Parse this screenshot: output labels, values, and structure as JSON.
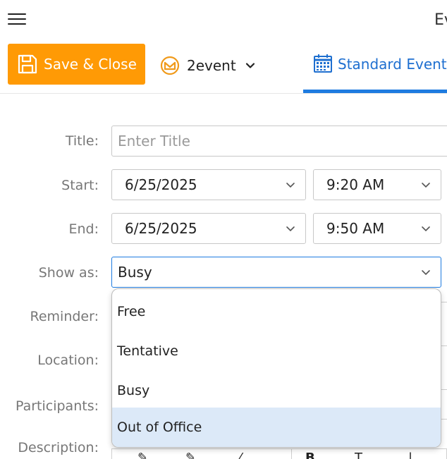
{
  "window": {
    "title": "Ev"
  },
  "toolbar": {
    "save_label": "Save & Close",
    "account_label": "2event",
    "event_type_label": "Standard Event",
    "accent": "#ff9a05",
    "tab_active_color": "#1e7be0"
  },
  "form": {
    "title_label": "Title:",
    "title_placeholder": "Enter Title",
    "title_value": "",
    "start_label": "Start:",
    "start_date": "6/25/2025",
    "start_time": "9:20 AM",
    "end_label": "End:",
    "end_date": "6/25/2025",
    "end_time": "9:50 AM",
    "show_as_label": "Show as:",
    "show_as_value": "Busy",
    "reminder_label": "Reminder:",
    "location_label": "Location:",
    "participants_label": "Participants:",
    "description_label": "Description:"
  },
  "show_as_dropdown": {
    "options": [
      "Free",
      "Tentative",
      "Busy",
      "Out of Office"
    ],
    "highlighted": "Out of Office"
  },
  "icons": {
    "menu": "hamburger-icon",
    "save": "floppy-disk-icon",
    "account": "envelope-icon",
    "calendar": "calendar-icon",
    "chevron": "chevron-down-icon"
  }
}
